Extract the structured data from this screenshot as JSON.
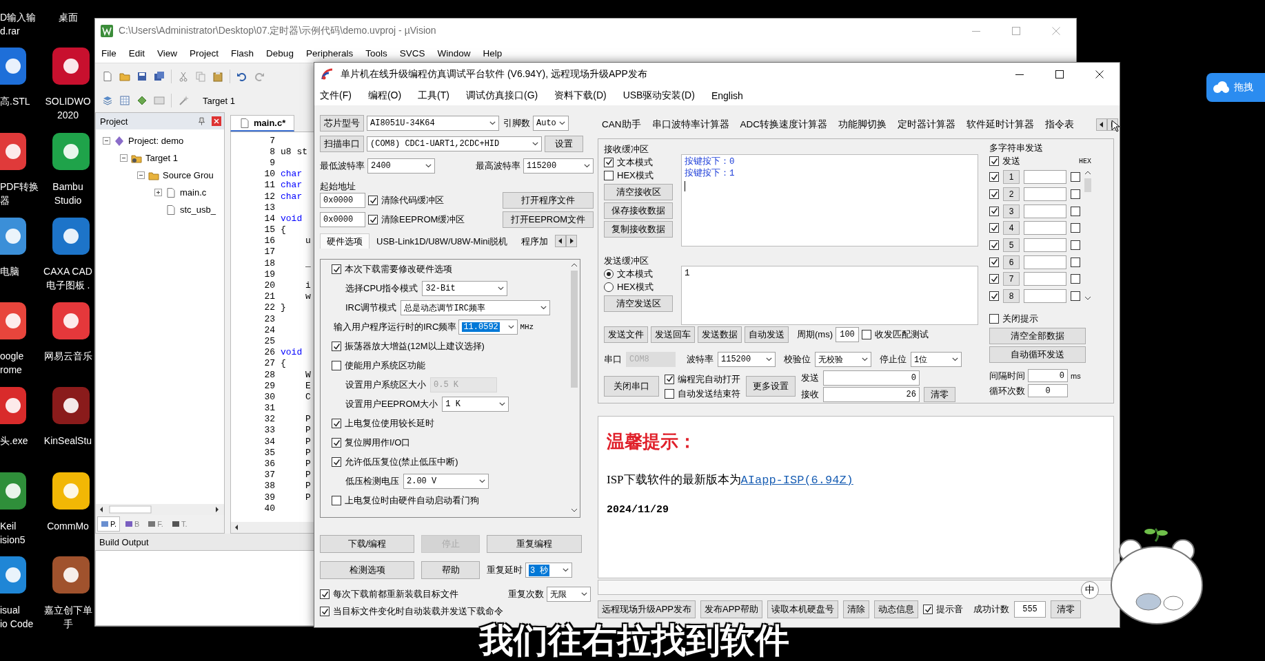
{
  "desktop_icons": [
    {
      "lines": [
        "D输入输",
        "d.rar"
      ]
    },
    {
      "lines": [
        "桌面"
      ]
    },
    {
      "lines": [
        "高.STL"
      ],
      "color": "#1e6fd9"
    },
    {
      "lines": [
        "SOLIDWO",
        "2020"
      ],
      "color": "#c8102e"
    },
    {
      "lines": [
        "PDF转换",
        "器"
      ],
      "color": "#e03a3a"
    },
    {
      "lines": [
        "Bambu",
        "Studio"
      ],
      "color": "#1fa34a"
    },
    {
      "lines": [
        "电脑"
      ],
      "color": "#3b8fd8"
    },
    {
      "lines": [
        "CAXA CAD",
        "电子图板 ."
      ],
      "color": "#1d74c9"
    },
    {
      "lines": [
        "oogle",
        "rome"
      ],
      "color": "#e8453c"
    },
    {
      "lines": [
        "网易云音乐"
      ],
      "color": "#e5383b"
    },
    {
      "lines": [
        "头.exe"
      ],
      "color": "#d92b2b"
    },
    {
      "lines": [
        "KinSealStu"
      ],
      "color": "#8a1b1b"
    },
    {
      "lines": [
        "Keil",
        "ision5"
      ],
      "color": "#2f8f3a"
    },
    {
      "lines": [
        "CommMo"
      ],
      "color": "#f2b705"
    },
    {
      "lines": [
        "isual",
        "io Code"
      ],
      "color": "#1f86d6"
    },
    {
      "lines": [
        "嘉立创下单",
        "手"
      ],
      "color": "#a0522d"
    }
  ],
  "keil_window": {
    "title": "C:\\Users\\Administrator\\Desktop\\07.定时器\\示例代码\\demo.uvproj - µVision",
    "menu": [
      "File",
      "Edit",
      "View",
      "Project",
      "Flash",
      "Debug",
      "Peripherals",
      "Tools",
      "SVCS",
      "Window",
      "Help"
    ],
    "target": "Target 1",
    "project_panel": {
      "title": "Project",
      "tree": [
        {
          "label": "Project: demo",
          "kind": "project",
          "expanded": true,
          "children": [
            {
              "label": "Target 1",
              "kind": "target",
              "expanded": true,
              "children": [
                {
                  "label": "Source Grou",
                  "kind": "group",
                  "expanded": true,
                  "children": [
                    {
                      "label": "main.c",
                      "kind": "file",
                      "expanded": false
                    },
                    {
                      "label": "stc_usb_",
                      "kind": "leaf"
                    }
                  ]
                }
              ]
            }
          ]
        }
      ],
      "panel_tabs": [
        {
          "label": "P.",
          "selected": true
        },
        {
          "label": "B",
          "selected": false
        },
        {
          "label": "F.",
          "selected": false
        },
        {
          "label": "T.",
          "selected": false
        }
      ]
    },
    "editor": {
      "tab": "main.c*",
      "lines": [
        {
          "number": "7",
          "kind": "blank"
        },
        {
          "number": "8",
          "kind": "plain",
          "code": "u8 st"
        },
        {
          "number": "9",
          "kind": "blank"
        },
        {
          "number": "10",
          "kind": "keyword",
          "code": "char"
        },
        {
          "number": "11",
          "kind": "keyword",
          "code": "char"
        },
        {
          "number": "12",
          "kind": "keyword",
          "code": "char"
        },
        {
          "number": "13",
          "kind": "blank"
        },
        {
          "number": "14",
          "kind": "keyword",
          "code": "void"
        },
        {
          "number": "15",
          "kind": "plain",
          "code": "{"
        },
        {
          "number": "16",
          "kind": "indented",
          "code": "u"
        },
        {
          "number": "17",
          "kind": "blank"
        },
        {
          "number": "18",
          "kind": "indented",
          "code": "_"
        },
        {
          "number": "19",
          "kind": "blank"
        },
        {
          "number": "20",
          "kind": "indented",
          "code": "i"
        },
        {
          "number": "21",
          "kind": "indented",
          "code": "w"
        },
        {
          "number": "22",
          "kind": "plain",
          "code": "}"
        },
        {
          "number": "23",
          "kind": "blank"
        },
        {
          "number": "24",
          "kind": "blank"
        },
        {
          "number": "25",
          "kind": "blank"
        },
        {
          "number": "26",
          "kind": "keyword",
          "code": "void"
        },
        {
          "number": "27",
          "kind": "plain",
          "code": "{"
        },
        {
          "number": "28",
          "kind": "indented",
          "code": "W"
        },
        {
          "number": "29",
          "kind": "indented",
          "code": "E"
        },
        {
          "number": "30",
          "kind": "indented",
          "code": "C"
        },
        {
          "number": "31",
          "kind": "blank"
        },
        {
          "number": "32",
          "kind": "indented",
          "code": "P"
        },
        {
          "number": "33",
          "kind": "indented",
          "code": "P"
        },
        {
          "number": "34",
          "kind": "indented",
          "code": "P"
        },
        {
          "number": "35",
          "kind": "indented",
          "code": "P"
        },
        {
          "number": "36",
          "kind": "indented",
          "code": "P"
        },
        {
          "number": "37",
          "kind": "indented",
          "code": "P"
        },
        {
          "number": "38",
          "kind": "indented",
          "code": "P"
        },
        {
          "number": "39",
          "kind": "indented",
          "code": "P"
        },
        {
          "number": "40",
          "kind": "blank"
        }
      ]
    },
    "build_output": {
      "title": "Build Output"
    }
  },
  "isp_window": {
    "title": "单片机在线升级编程仿真调试平台软件 (V6.94Y), 远程现场升级APP发布",
    "menu": [
      "文件(F)",
      "编程(O)",
      "工具(T)",
      "调试仿真接口(G)",
      "资料下载(D)",
      "USB驱动安装(D)",
      "English"
    ],
    "left": {
      "chip": {
        "button": "芯片型号",
        "value": "AI8051U-34K64",
        "pins_label": "引脚数",
        "pins": "Auto"
      },
      "port": {
        "button": "扫描串口",
        "value": "(COM8) CDC1-UART1,2CDC+HID",
        "settings": "设置"
      },
      "baud": {
        "min_label": "最低波特率",
        "min": "2400",
        "max_label": "最高波特率",
        "max": "115200"
      },
      "start_address": {
        "label": "起始地址",
        "rows": [
          {
            "address": "0x0000",
            "option": "清除代码缓冲区",
            "checked": true,
            "button": "打开程序文件"
          },
          {
            "address": "0x0000",
            "option": "清除EEPROM缓冲区",
            "checked": true,
            "button": "打开EEPROM文件"
          }
        ]
      },
      "tabs": [
        {
          "label": "硬件选项",
          "selected": true
        },
        {
          "label": "USB-Link1D/U8W/U8W-Mini脱机",
          "selected": false
        },
        {
          "label": "程序加",
          "selected": false
        }
      ],
      "options": [
        {
          "kind": "check",
          "label": "本次下载需要修改硬件选项",
          "checked": true
        },
        {
          "kind": "select",
          "label": "选择CPU指令模式",
          "value": "32-Bit",
          "disabled": false
        },
        {
          "kind": "select",
          "label": "IRC调节模式",
          "value": "总是动态调节IRC频率",
          "disabled": false
        },
        {
          "kind": "freq",
          "label": "输入用户程序运行时的IRC频率",
          "value": "11.0592",
          "unit": "MHz",
          "text_selected": true
        },
        {
          "kind": "check",
          "label": "振荡器放大增益(12M以上建议选择)",
          "checked": true
        },
        {
          "kind": "check",
          "label": "使能用户系统区功能",
          "checked": false
        },
        {
          "kind": "select",
          "label": "设置用户系统区大小",
          "value": "0.5 K",
          "disabled": true
        },
        {
          "kind": "select",
          "label": "设置用户EEPROM大小",
          "value": "1 K",
          "disabled": false
        },
        {
          "kind": "check",
          "label": "上电复位使用较长延时",
          "checked": true
        },
        {
          "kind": "check",
          "label": "复位脚用作I/O口",
          "checked": true
        },
        {
          "kind": "check",
          "label": "允许低压复位(禁止低压中断)",
          "checked": true
        },
        {
          "kind": "select",
          "label": "低压检测电压",
          "value": "2.00 V",
          "disabled": false
        },
        {
          "kind": "check",
          "label": "上电复位时由硬件自动启动看门狗",
          "checked": false
        }
      ],
      "actions": [
        {
          "label": "下载/编程",
          "disabled": false
        },
        {
          "label": "停止",
          "disabled": true
        },
        {
          "label": "重复编程",
          "disabled": false
        },
        {
          "label": "检测选项",
          "disabled": false
        },
        {
          "label": "帮助",
          "disabled": false
        }
      ],
      "repeat_delay": {
        "label": "重复延时",
        "value": "3 秒",
        "text_selected": true
      },
      "repeat_count": {
        "label": "重复次数",
        "value": "无限"
      },
      "footer_checks": [
        {
          "label": "每次下载前都重新装载目标文件",
          "checked": true
        },
        {
          "label": "当目标文件变化时自动装载并发送下载命令",
          "checked": true
        }
      ]
    },
    "right": {
      "tabs": [
        "CAN助手",
        "串口波特率计算器",
        "ADC转换速度计算器",
        "功能脚切换",
        "定时器计算器",
        "软件延时计算器",
        "指令表"
      ],
      "receive": {
        "title": "接收缓冲区",
        "modes": [
          {
            "label": "文本模式",
            "checked": true
          },
          {
            "label": "HEX模式",
            "checked": false
          }
        ],
        "buttons": [
          "清空接收区",
          "保存接收数据",
          "复制接收数据"
        ],
        "lines": [
          "按键按下：0",
          "按键按下：1"
        ]
      },
      "send": {
        "title": "发送缓冲区",
        "modes": [
          {
            "label": "文本模式",
            "selected": true
          },
          {
            "label": "HEX模式",
            "selected": false
          }
        ],
        "button": "清空发送区",
        "text": "1"
      },
      "send_buttons": [
        "发送文件",
        "发送回车",
        "发送数据",
        "自动发送"
      ],
      "period": {
        "label": "周期(ms)",
        "value": "100"
      },
      "match_test": {
        "label": "收发匹配测试",
        "checked": false
      },
      "serial": {
        "port_label": "串口",
        "port": "COM8",
        "baud_label": "波特率",
        "baud": "115200",
        "parity_label": "校验位",
        "parity": "无校验",
        "stop_label": "停止位",
        "stop": "1位"
      },
      "close_port": "关闭串口",
      "auto_checks": [
        {
          "label": "编程完自动打开",
          "checked": true
        },
        {
          "label": "自动发送结束符",
          "checked": false
        }
      ],
      "more": "更多设置",
      "counters": [
        {
          "label": "发送",
          "value": "0"
        },
        {
          "label": "接收",
          "value": "26"
        }
      ],
      "clear": "清零",
      "multi": {
        "title": "多字符串发送",
        "send_all": {
          "label": "发送",
          "checked": true
        },
        "hex_label": "HEX",
        "rows": [
          {
            "number": "1",
            "checked": true,
            "hex": false
          },
          {
            "number": "2",
            "checked": true,
            "hex": false
          },
          {
            "number": "3",
            "checked": true,
            "hex": false
          },
          {
            "number": "4",
            "checked": true,
            "hex": false
          },
          {
            "number": "5",
            "checked": true,
            "hex": false
          },
          {
            "number": "6",
            "checked": true,
            "hex": false
          },
          {
            "number": "7",
            "checked": true,
            "hex": false
          },
          {
            "number": "8",
            "checked": true,
            "hex": false
          }
        ],
        "close_hint": {
          "label": "关闭提示",
          "checked": false
        },
        "buttons": [
          "清空全部数据",
          "自动循环发送"
        ],
        "interval": {
          "label": "间隔时间",
          "value": "0",
          "unit": "ms"
        },
        "loops": {
          "label": "循环次数",
          "value": "0"
        }
      }
    },
    "notice": {
      "title": "温馨提示：",
      "text": "ISP下载软件的最新版本为",
      "link": "AIapp-ISP(6.94Z)",
      "date": "2024/11/29"
    },
    "bottom_bar": {
      "buttons": [
        "远程现场升级APP发布",
        "发布APP帮助",
        "读取本机硬盘号",
        "清除",
        "动态信息"
      ],
      "sound": {
        "label": "提示音",
        "checked": true
      },
      "count_label": "成功计数",
      "count": "555",
      "clear": "清零"
    }
  },
  "ime_indicator": "中",
  "side_button": {
    "label": "拖拽"
  },
  "subtitle": "我们往右拉找到软件"
}
